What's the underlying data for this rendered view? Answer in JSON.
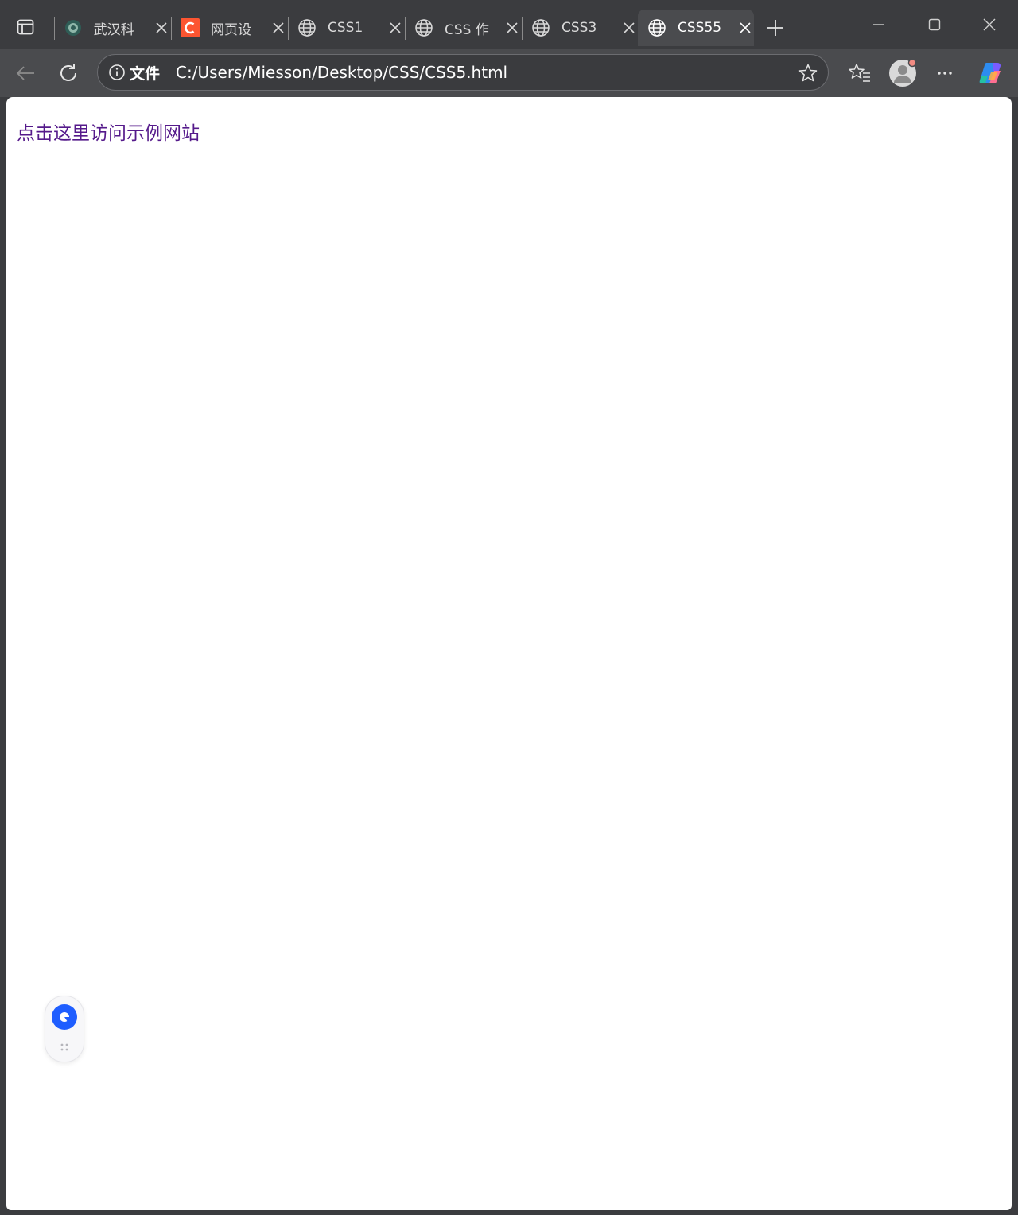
{
  "tabs": [
    {
      "title": "武汉科",
      "active": false,
      "icon": "school-emblem-icon"
    },
    {
      "title": "网页设",
      "active": false,
      "icon": "csdn-c-icon"
    },
    {
      "title": "CSS1",
      "active": false,
      "icon": "globe-icon"
    },
    {
      "title": "CSS 作",
      "active": false,
      "icon": "globe-icon"
    },
    {
      "title": "CSS3",
      "active": false,
      "icon": "globe-icon"
    },
    {
      "title": "CSS55",
      "active": true,
      "icon": "globe-icon"
    }
  ],
  "address_bar": {
    "scheme_label": "文件",
    "url": "C:/Users/Miesson/Desktop/CSS/CSS5.html"
  },
  "page": {
    "link_text": "点击这里访问示例网站",
    "link_color": "#551a8b"
  },
  "colors": {
    "chrome_bg": "#3b3c3f",
    "toolbar_bg": "#4a4b4e",
    "csdn_red": "#fc5531",
    "floater_accent": "#1f5eff"
  }
}
